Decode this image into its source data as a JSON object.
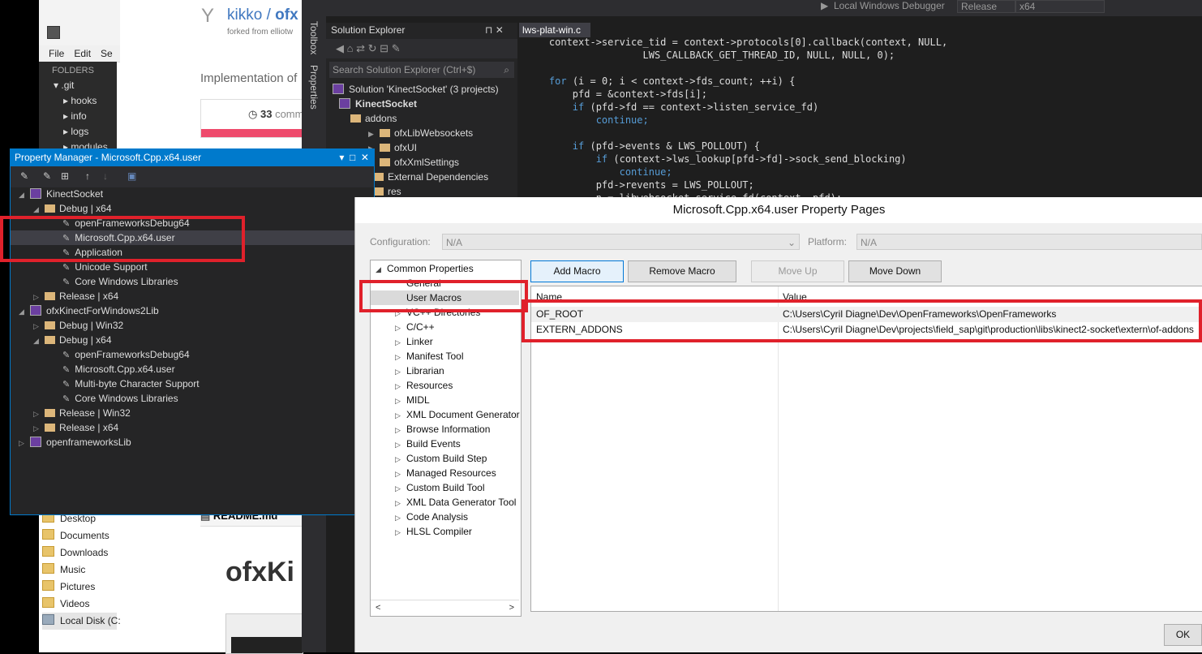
{
  "explorer": {
    "menu": [
      "File",
      "Edit",
      "Se"
    ],
    "folders_header": "FOLDERS",
    "tree": [
      ".git",
      "hooks",
      "info",
      "logs",
      "modules"
    ],
    "nav": [
      "Desktop",
      "Documents",
      "Downloads",
      "Music",
      "Pictures",
      "Videos",
      "Local Disk (C:"
    ]
  },
  "github": {
    "user": "kikko",
    "repo": "ofx",
    "forked_from": "forked from elliotw",
    "description": "Implementation of",
    "commits_count": "33",
    "commits_label": "comm",
    "readme": "README.md",
    "heading": "ofxKi"
  },
  "vs_toolbar": {
    "debugger": "Local Windows Debugger",
    "config": "Release",
    "platform": "x64"
  },
  "side_labels": {
    "toolbox": "Toolbox",
    "properties": "Properties"
  },
  "solution_explorer": {
    "title": "Solution Explorer",
    "search_placeholder": "Search Solution Explorer (Ctrl+$)",
    "items": [
      "Solution 'KinectSocket' (3 projects)",
      "KinectSocket",
      "addons",
      "ofxLibWebsockets",
      "ofxUI",
      "ofxXmlSettings",
      "External Dependencies",
      "res"
    ]
  },
  "editor": {
    "tab": "lws-plat-win.c",
    "lines": [
      "    context->service_tid = context->protocols[0].callback(context, NULL,",
      "                    LWS_CALLBACK_GET_THREAD_ID, NULL, NULL, 0);",
      "",
      "    for (i = 0; i < context->fds_count; ++i) {",
      "        pfd = &context->fds[i];",
      "        if (pfd->fd == context->listen_service_fd)",
      "            continue;",
      "",
      "        if (pfd->events & LWS_POLLOUT) {",
      "            if (context->lws_lookup[pfd->fd]->sock_send_blocking)",
      "                continue;",
      "            pfd->revents = LWS_POLLOUT;",
      "            n = libwebsocket_service_fd(context, pfd);"
    ]
  },
  "property_manager": {
    "title": "Property Manager - Microsoft.Cpp.x64.user",
    "rows": [
      "KinectSocket",
      "Debug | x64",
      "openFrameworksDebug64",
      "Microsoft.Cpp.x64.user",
      "Application",
      "Unicode Support",
      "Core Windows Libraries",
      "Release | x64",
      "ofxKinectForWindows2Lib",
      "Debug | Win32",
      "Debug | x64",
      "openFrameworksDebug64",
      "Microsoft.Cpp.x64.user",
      "Multi-byte Character Support",
      "Core Windows Libraries",
      "Release | Win32",
      "Release | x64",
      "openframeworksLib"
    ]
  },
  "dialog": {
    "title": "Microsoft.Cpp.x64.user Property Pages",
    "configuration_label": "Configuration:",
    "configuration_value": "N/A",
    "platform_label": "Platform:",
    "platform_value": "N/A",
    "tree": [
      "Common Properties",
      "General",
      "User Macros",
      "VC++ Directories",
      "C/C++",
      "Linker",
      "Manifest Tool",
      "Librarian",
      "Resources",
      "MIDL",
      "XML Document Generator",
      "Browse Information",
      "Build Events",
      "Custom Build Step",
      "Managed Resources",
      "Custom Build Tool",
      "XML Data Generator Tool",
      "Code Analysis",
      "HLSL Compiler"
    ],
    "buttons": {
      "add": "Add Macro",
      "remove": "Remove Macro",
      "up": "Move Up",
      "down": "Move Down",
      "ok": "OK"
    },
    "columns": {
      "name": "Name",
      "value": "Value"
    },
    "macros": [
      {
        "name": "OF_ROOT",
        "value": "C:\\Users\\Cyril Diagne\\Dev\\OpenFrameworks\\OpenFrameworks"
      },
      {
        "name": "EXTERN_ADDONS",
        "value": "C:\\Users\\Cyril Diagne\\Dev\\projects\\field_sap\\git\\production\\libs\\kinect2-socket\\extern\\of-addons"
      }
    ]
  },
  "colors": {
    "accent": "#007acc",
    "highlight": "#e0212b"
  }
}
